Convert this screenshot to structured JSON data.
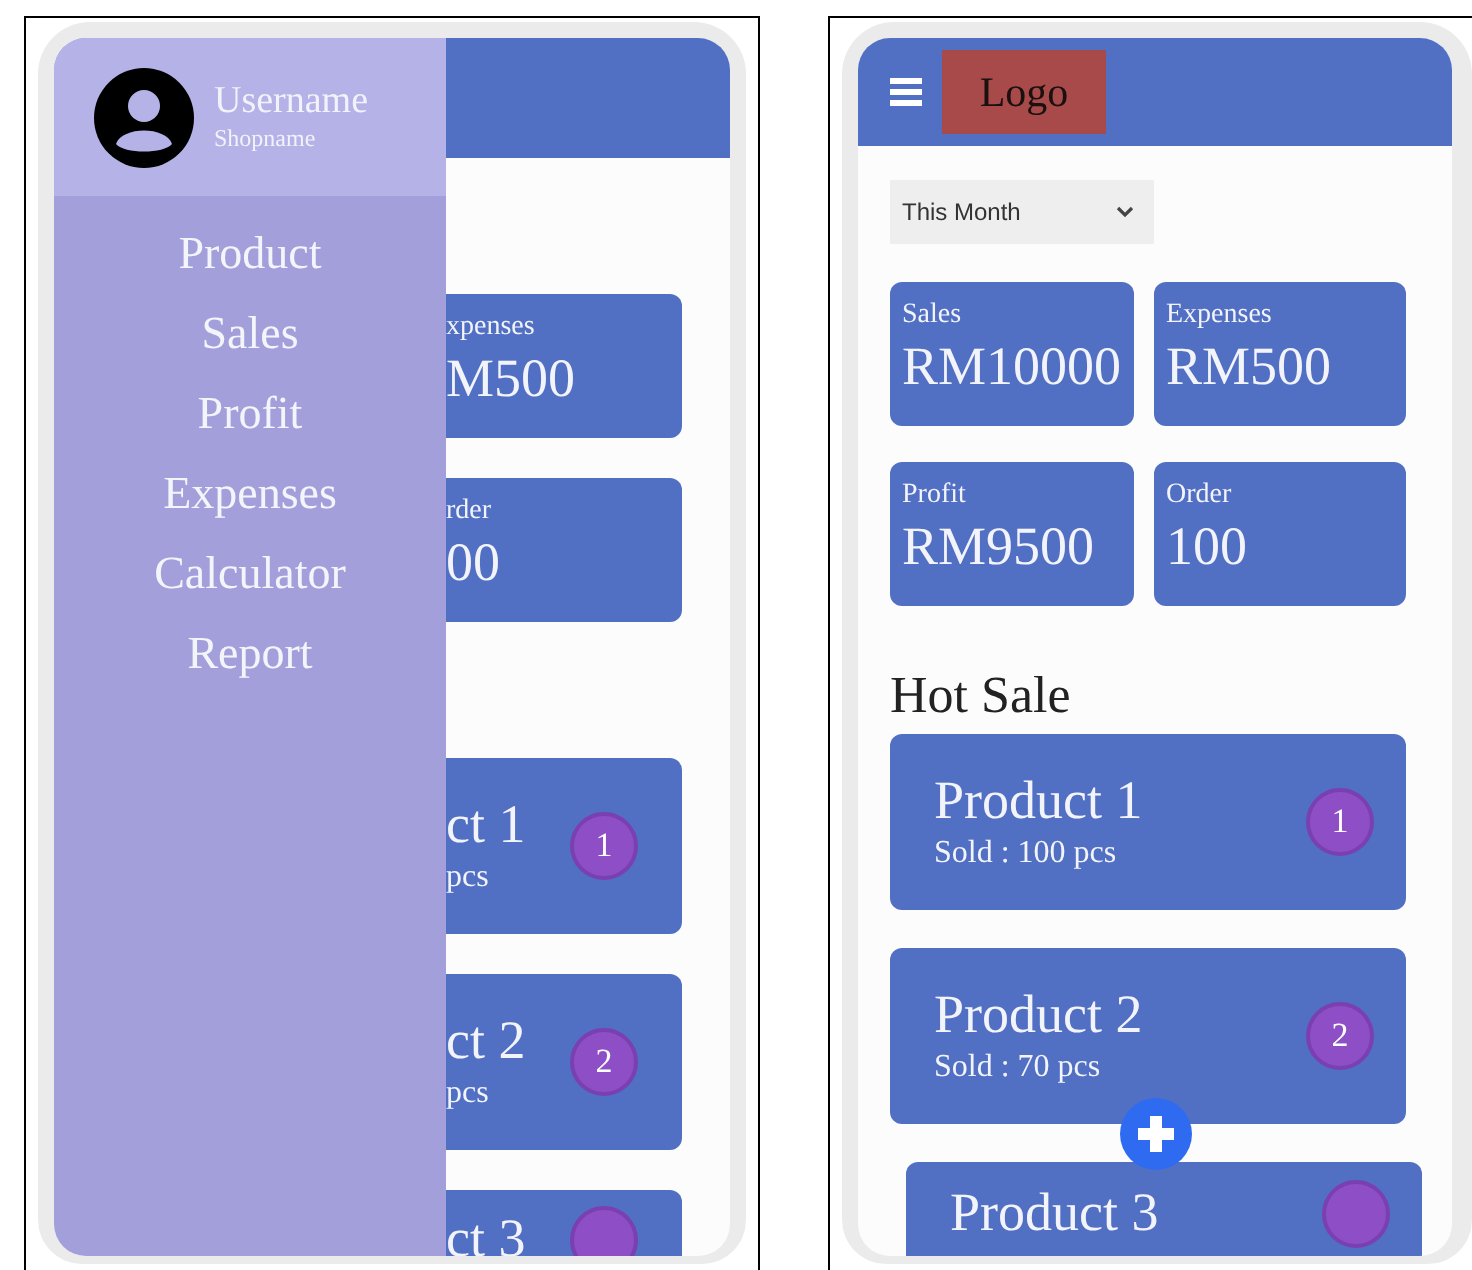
{
  "left_screen": {
    "drawer": {
      "username": "Username",
      "shopname": "Shopname",
      "items": [
        {
          "label": "Product"
        },
        {
          "label": "Sales"
        },
        {
          "label": "Profit"
        },
        {
          "label": "Expenses"
        },
        {
          "label": "Calculator"
        },
        {
          "label": "Report"
        }
      ]
    },
    "stats": [
      {
        "label": "xpenses",
        "value": "M500"
      },
      {
        "label": "rder",
        "value": "00"
      }
    ],
    "products": [
      {
        "name": "ct 1",
        "sold": "pcs",
        "rank": "1"
      },
      {
        "name": "ct 2",
        "sold": "pcs",
        "rank": "2"
      },
      {
        "name": "ct 3"
      }
    ]
  },
  "right_screen": {
    "logo": "Logo",
    "period": "This Month",
    "stats": [
      {
        "label": "Sales",
        "value": "RM10000"
      },
      {
        "label": "Expenses",
        "value": "RM500"
      },
      {
        "label": "Profit",
        "value": "RM9500"
      },
      {
        "label": "Order",
        "value": "100"
      }
    ],
    "section_title": "Hot Sale",
    "products": [
      {
        "name": "Product 1",
        "sold": "Sold : 100 pcs",
        "rank": "1"
      },
      {
        "name": "Product 2",
        "sold": "Sold : 70 pcs",
        "rank": "2"
      },
      {
        "name": "Product 3"
      }
    ]
  }
}
